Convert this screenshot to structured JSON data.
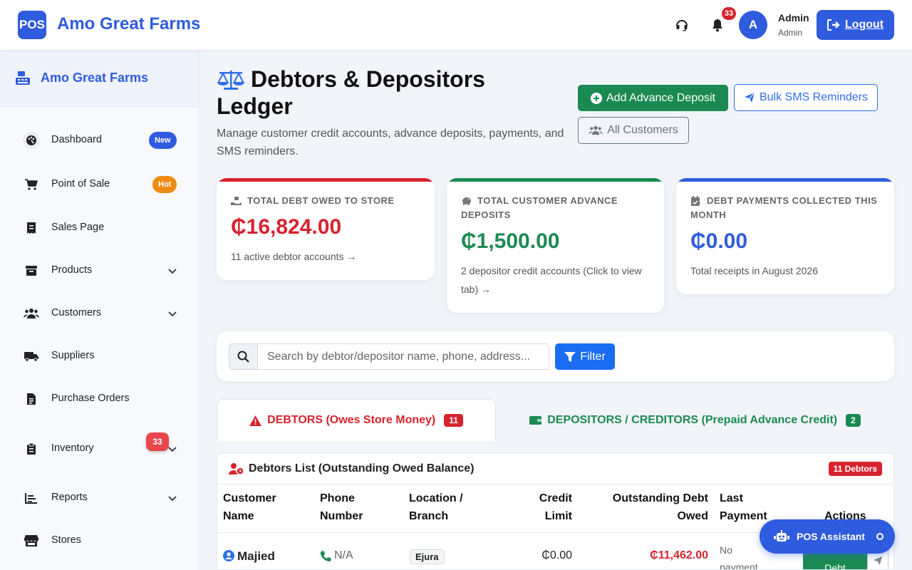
{
  "topbar": {
    "logo_text": "POS",
    "brand": "Amo Great Farms",
    "notification_count": "33",
    "avatar_initial": "A",
    "user_name": "Admin",
    "user_role": "Admin",
    "logout_label": "Logout"
  },
  "sidebar": {
    "title": "Amo Great Farms",
    "items": [
      {
        "label": "Dashboard",
        "icon": "palette-icon",
        "badge": "New",
        "badge_color": "#2f5cde"
      },
      {
        "label": "Point of Sale",
        "icon": "cart-icon",
        "badge": "Hot",
        "badge_color": "#ee8c12"
      },
      {
        "label": "Sales Page",
        "icon": "receipt-icon"
      },
      {
        "label": "Products",
        "icon": "box-icon",
        "has_submenu": true
      },
      {
        "label": "Customers",
        "icon": "users-icon",
        "has_submenu": true
      },
      {
        "label": "Suppliers",
        "icon": "truck-icon"
      },
      {
        "label": "Purchase Orders",
        "icon": "document-icon"
      },
      {
        "label": "Inventory",
        "icon": "clipboard-icon",
        "has_submenu": true,
        "badge": "33"
      },
      {
        "label": "Reports",
        "icon": "chart-icon",
        "has_submenu": true
      },
      {
        "label": "Stores",
        "icon": "store-icon"
      }
    ]
  },
  "header": {
    "title": "Debtors & Depositors Ledger",
    "subtitle": "Manage customer credit accounts, advance deposits, payments, and SMS reminders.",
    "add_deposit_label": "Add Advance Deposit",
    "bulk_sms_label": "Bulk SMS Reminders",
    "all_customers_label": "All Customers"
  },
  "stats": [
    {
      "caption": "TOTAL DEBT OWED TO STORE",
      "value": "₵16,824.00",
      "note": "11 active debtor accounts →",
      "color": "#d8232f"
    },
    {
      "caption": "TOTAL CUSTOMER ADVANCE DEPOSITS",
      "value": "₵1,500.00",
      "note": "2 depositor credit accounts (Click to view tab) →",
      "color": "#1b8a52"
    },
    {
      "caption": "DEBT PAYMENTS COLLECTED THIS MONTH",
      "value": "₵0.00",
      "note": "Total receipts in August 2026",
      "color": "#2f5cde"
    }
  ],
  "search": {
    "placeholder": "Search by debtor/depositor name, phone, address...",
    "filter_label": "Filter"
  },
  "tabs": {
    "debtors_label": "DEBTORS (Owes Store Money)",
    "debtors_count": "11",
    "depositors_label": "DEPOSITORS / CREDITORS (Prepaid Advance Credit)",
    "depositors_count": "2"
  },
  "ledger": {
    "title": "Debtors List (Outstanding Owed Balance)",
    "count_label": "11 Debtors",
    "columns": {
      "customer_name": "Customer Name",
      "phone_number": "Phone Number",
      "location": "Location / Branch",
      "credit_limit": "Credit Limit",
      "outstanding": "Outstanding Debt Owed",
      "last_payment": "Last Payment",
      "actions": "Actions"
    },
    "rows": [
      {
        "name": "Majied",
        "phone": "N/A",
        "location": "Ejura",
        "credit_limit": "₵0.00",
        "outstanding": "₵11,462.00",
        "last_payment": "No payment yet",
        "pay_label": "Debt"
      }
    ]
  },
  "assistant": {
    "label": "POS Assistant"
  }
}
